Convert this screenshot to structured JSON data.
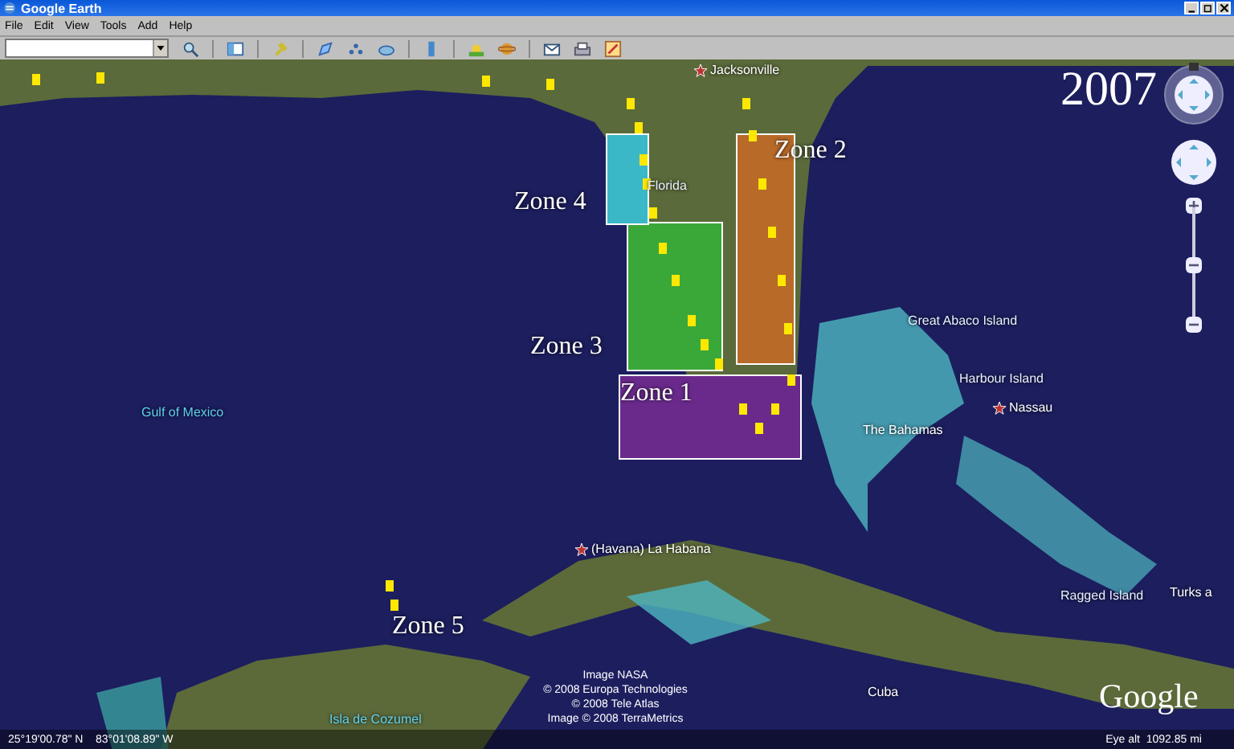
{
  "window": {
    "title": "Google Earth"
  },
  "menu": [
    "File",
    "Edit",
    "View",
    "Tools",
    "Add",
    "Help"
  ],
  "map": {
    "year": "2007",
    "places": [
      {
        "kind": "city",
        "label": "Jacksonville"
      },
      {
        "kind": "region",
        "label": "Florida"
      },
      {
        "kind": "sea",
        "label": "Gulf of Mexico"
      },
      {
        "kind": "region",
        "label": "Great Abaco Island"
      },
      {
        "kind": "region",
        "label": "Harbour Island"
      },
      {
        "kind": "capital",
        "label": "Nassau"
      },
      {
        "kind": "country",
        "label": "The Bahamas"
      },
      {
        "kind": "capital",
        "label": "(Havana) La Habana"
      },
      {
        "kind": "region",
        "label": "Ragged Island"
      },
      {
        "kind": "country",
        "label": "Turks a"
      },
      {
        "kind": "country",
        "label": "Cuba"
      },
      {
        "kind": "sea",
        "label": "Isla de Cozumel"
      }
    ],
    "zones": [
      {
        "label": "Zone 1",
        "color": "#6a2a8c"
      },
      {
        "label": "Zone 2",
        "color": "#b86a28"
      },
      {
        "label": "Zone 3",
        "color": "#3aa838"
      },
      {
        "label": "Zone 4",
        "color": "#3ab8c8"
      },
      {
        "label": "Zone 5"
      }
    ],
    "credits": [
      "Image NASA",
      "© 2008 Europa Technologies",
      "© 2008 Tele Atlas",
      "Image © 2008 TerraMetrics"
    ],
    "logo": "Google",
    "zoom": {
      "level": 0.5
    },
    "coordinates": "25°19'00.78\" N    83°01'08.89\" W",
    "eye_alt": "Eye alt  1092.85 mi"
  }
}
